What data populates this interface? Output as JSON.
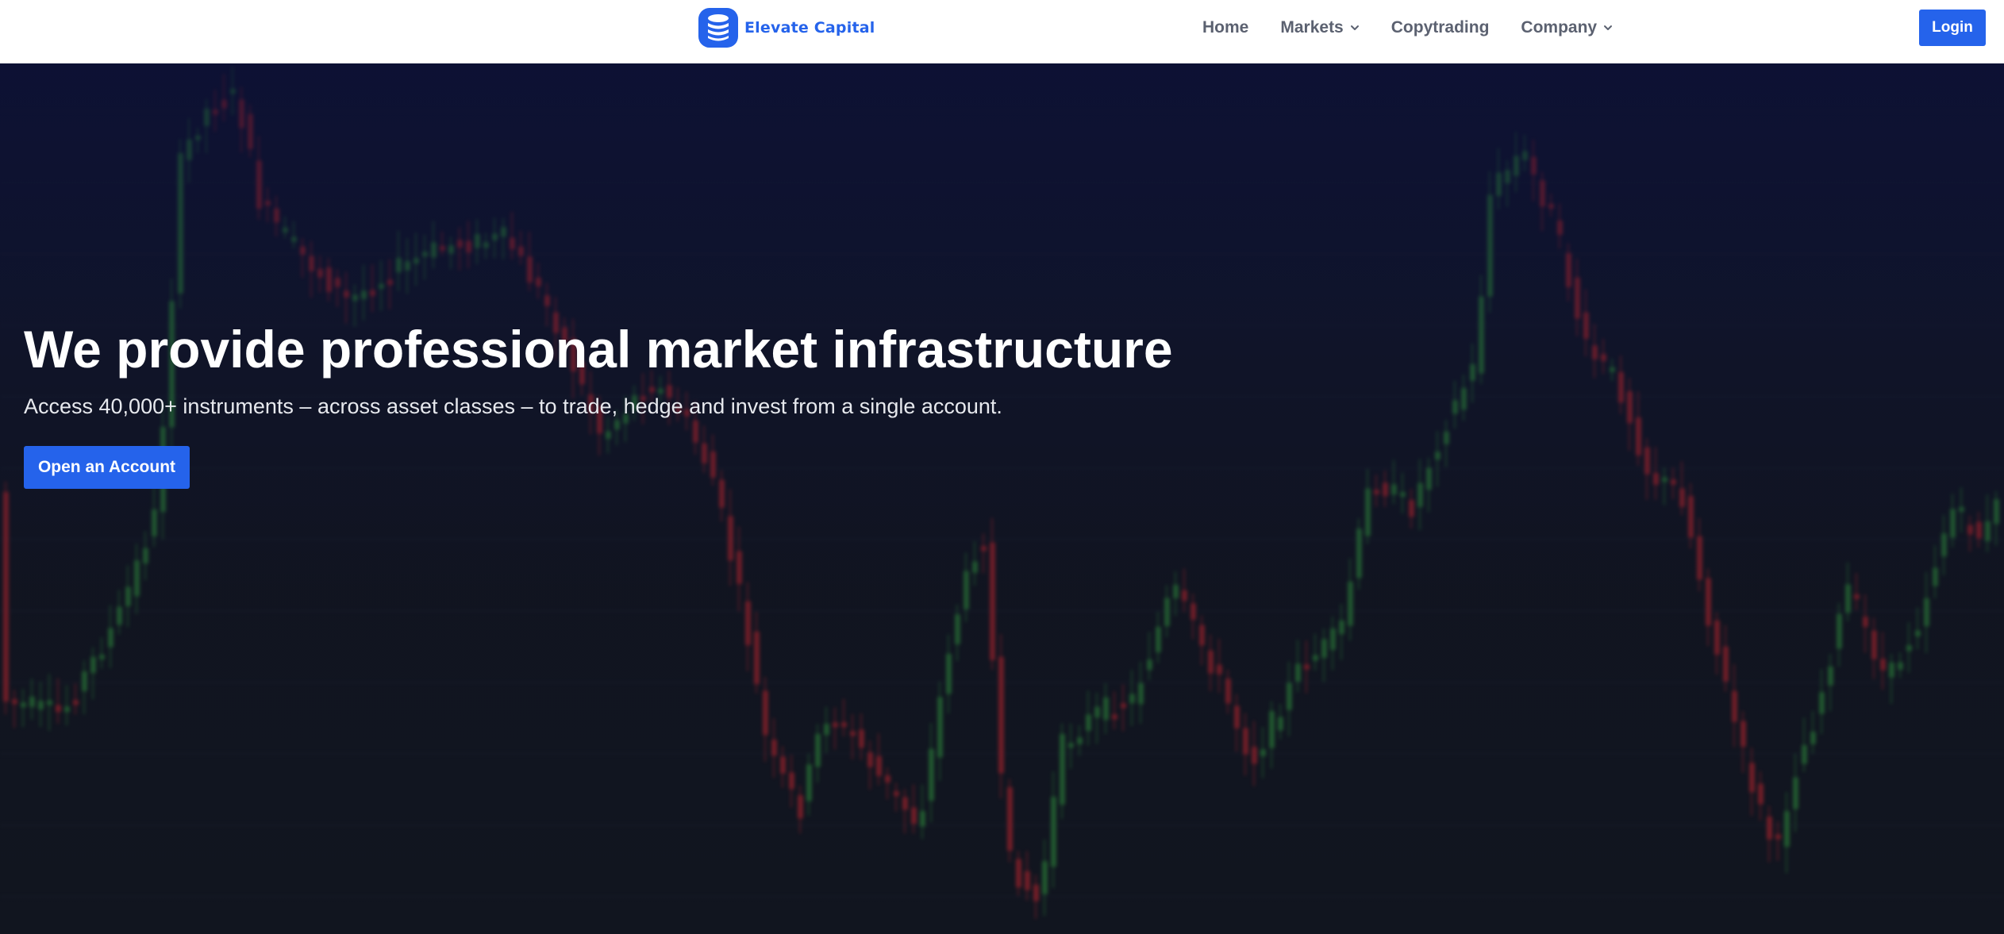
{
  "brand": {
    "name": "Elevate Capital",
    "logo_icon": "coin-stack-icon",
    "color": "#2563eb"
  },
  "nav": {
    "items": [
      {
        "label": "Home",
        "has_dropdown": false
      },
      {
        "label": "Markets",
        "has_dropdown": true
      },
      {
        "label": "Copytrading",
        "has_dropdown": false
      },
      {
        "label": "Company",
        "has_dropdown": true
      }
    ],
    "login_label": "Login"
  },
  "hero": {
    "title": "We provide professional market infrastructure",
    "subtitle": "Access 40,000+ instruments – across asset classes – to trade, hedge and invest from a single account.",
    "cta_label": "Open an Account",
    "background": "blurred candlestick chart"
  },
  "colors": {
    "accent": "#2563eb",
    "nav_text": "#5b6170",
    "hero_bg": "#11151f",
    "candle_up": "#2f8f3c",
    "candle_down": "#c2262e"
  }
}
